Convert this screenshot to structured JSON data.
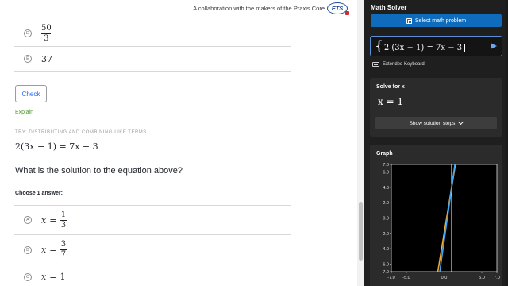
{
  "header": {
    "collab_text": "A collaboration with the makers of the Praxis Core",
    "logo_text": "ETS"
  },
  "previous_choices": [
    {
      "letter": "D",
      "num": "50",
      "den": "3"
    },
    {
      "letter": "E",
      "value": "37"
    }
  ],
  "check_label": "Check",
  "explain_label": "Explain",
  "try_title": "TRY: DISTRIBUTING AND COMBINING LIKE TERMS",
  "problem": {
    "equation": "2(3x − 1) = 7x − 3",
    "question": "What is the solution to the equation above?",
    "choose": "Choose 1 answer:"
  },
  "choices": [
    {
      "letter": "A",
      "lhs": "x",
      "eq": "=",
      "num": "1",
      "den": "3"
    },
    {
      "letter": "B",
      "lhs": "x",
      "eq": "=",
      "num": "3",
      "den": "7"
    },
    {
      "letter": "C",
      "lhs": "x",
      "eq": "=",
      "value": "1"
    }
  ],
  "solver": {
    "title": "Math Solver",
    "select_label": "Select math problem",
    "input_value": "2 (3x − 1) = 7x − 3",
    "keyboard_label": "Extended Keyboard",
    "solve_title": "Solve for x",
    "answer": "x = 1",
    "steps_label": "Show solution steps",
    "graph_title": "Graph"
  },
  "chart_data": {
    "type": "line",
    "title": "Graph",
    "xlim": [
      -7,
      7
    ],
    "ylim": [
      -7,
      7
    ],
    "x_ticks": [
      "-7.0",
      "-5.0",
      "0.0",
      "5.0",
      "7.0"
    ],
    "y_ticks": [
      "7.0",
      "6.0",
      "4.0",
      "2.0",
      "0.0",
      "-2.0",
      "-4.0",
      "-6.0",
      "-7.0"
    ],
    "series": [
      {
        "function": "2(3x − 1)",
        "color": "#f0a93b",
        "points": [
          [
            -0.833,
            -7
          ],
          [
            1.5,
            7
          ]
        ]
      },
      {
        "function": "7x − 3",
        "color": "#3fa9f5",
        "points": [
          [
            -0.571,
            -7
          ],
          [
            1.429,
            7
          ]
        ]
      }
    ],
    "vertical_line": {
      "x": 1,
      "color": "#ffffff"
    },
    "grid": false
  },
  "colors": {
    "accent_blue": "#1865f2",
    "explain_green": "#4f9a2f",
    "solver_bg": "#1f1f1f",
    "solver_button": "#0f6cbd"
  }
}
